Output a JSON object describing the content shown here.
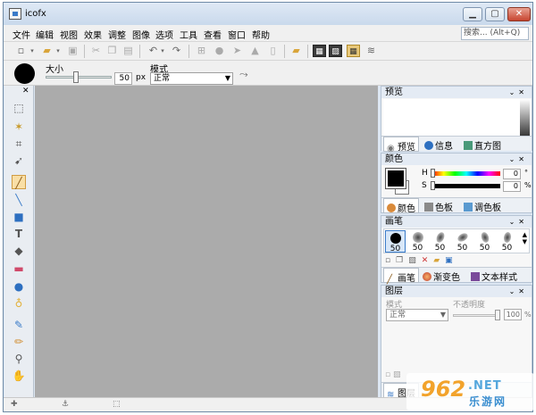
{
  "window": {
    "title": "icofx"
  },
  "menu": {
    "items": [
      "文件",
      "编辑",
      "视图",
      "效果",
      "调整",
      "图像",
      "选项",
      "工具",
      "查看",
      "窗口",
      "帮助"
    ],
    "search_placeholder": "搜索... (Alt+Q)"
  },
  "options": {
    "size_label": "大小",
    "size_value": "50",
    "size_unit": "px",
    "mode_label": "模式",
    "mode_value": "正常"
  },
  "panels": {
    "preview": {
      "title": "预览",
      "tabs": [
        "预览",
        "信息",
        "直方图"
      ]
    },
    "color": {
      "title": "颜色",
      "channels": [
        {
          "label": "H",
          "value": "0",
          "unit": "°"
        },
        {
          "label": "S",
          "value": "0",
          "unit": "%"
        },
        {
          "label": "B",
          "value": "",
          "unit": ""
        }
      ],
      "tabs": [
        "颜色",
        "色板",
        "调色板"
      ]
    },
    "brushes": {
      "title": "画笔",
      "sizes": [
        "50",
        "50",
        "50",
        "50",
        "50",
        "50"
      ],
      "tabs": [
        "画笔",
        "渐变色",
        "文本样式"
      ]
    },
    "layers": {
      "title": "图层",
      "mode_label": "模式",
      "opacity_label": "不透明度",
      "mode_value": "正常",
      "opacity_value": "100",
      "opacity_unit": "%",
      "tab": "图层"
    }
  },
  "watermark": {
    "num": "962",
    "net": ".NET",
    "cn": "乐游网"
  },
  "colors": {
    "titlebar": "#c9d9ec",
    "canvas": "#ababab",
    "panel_bg": "#dce6f2",
    "accent_orange": "#f2a32c"
  }
}
